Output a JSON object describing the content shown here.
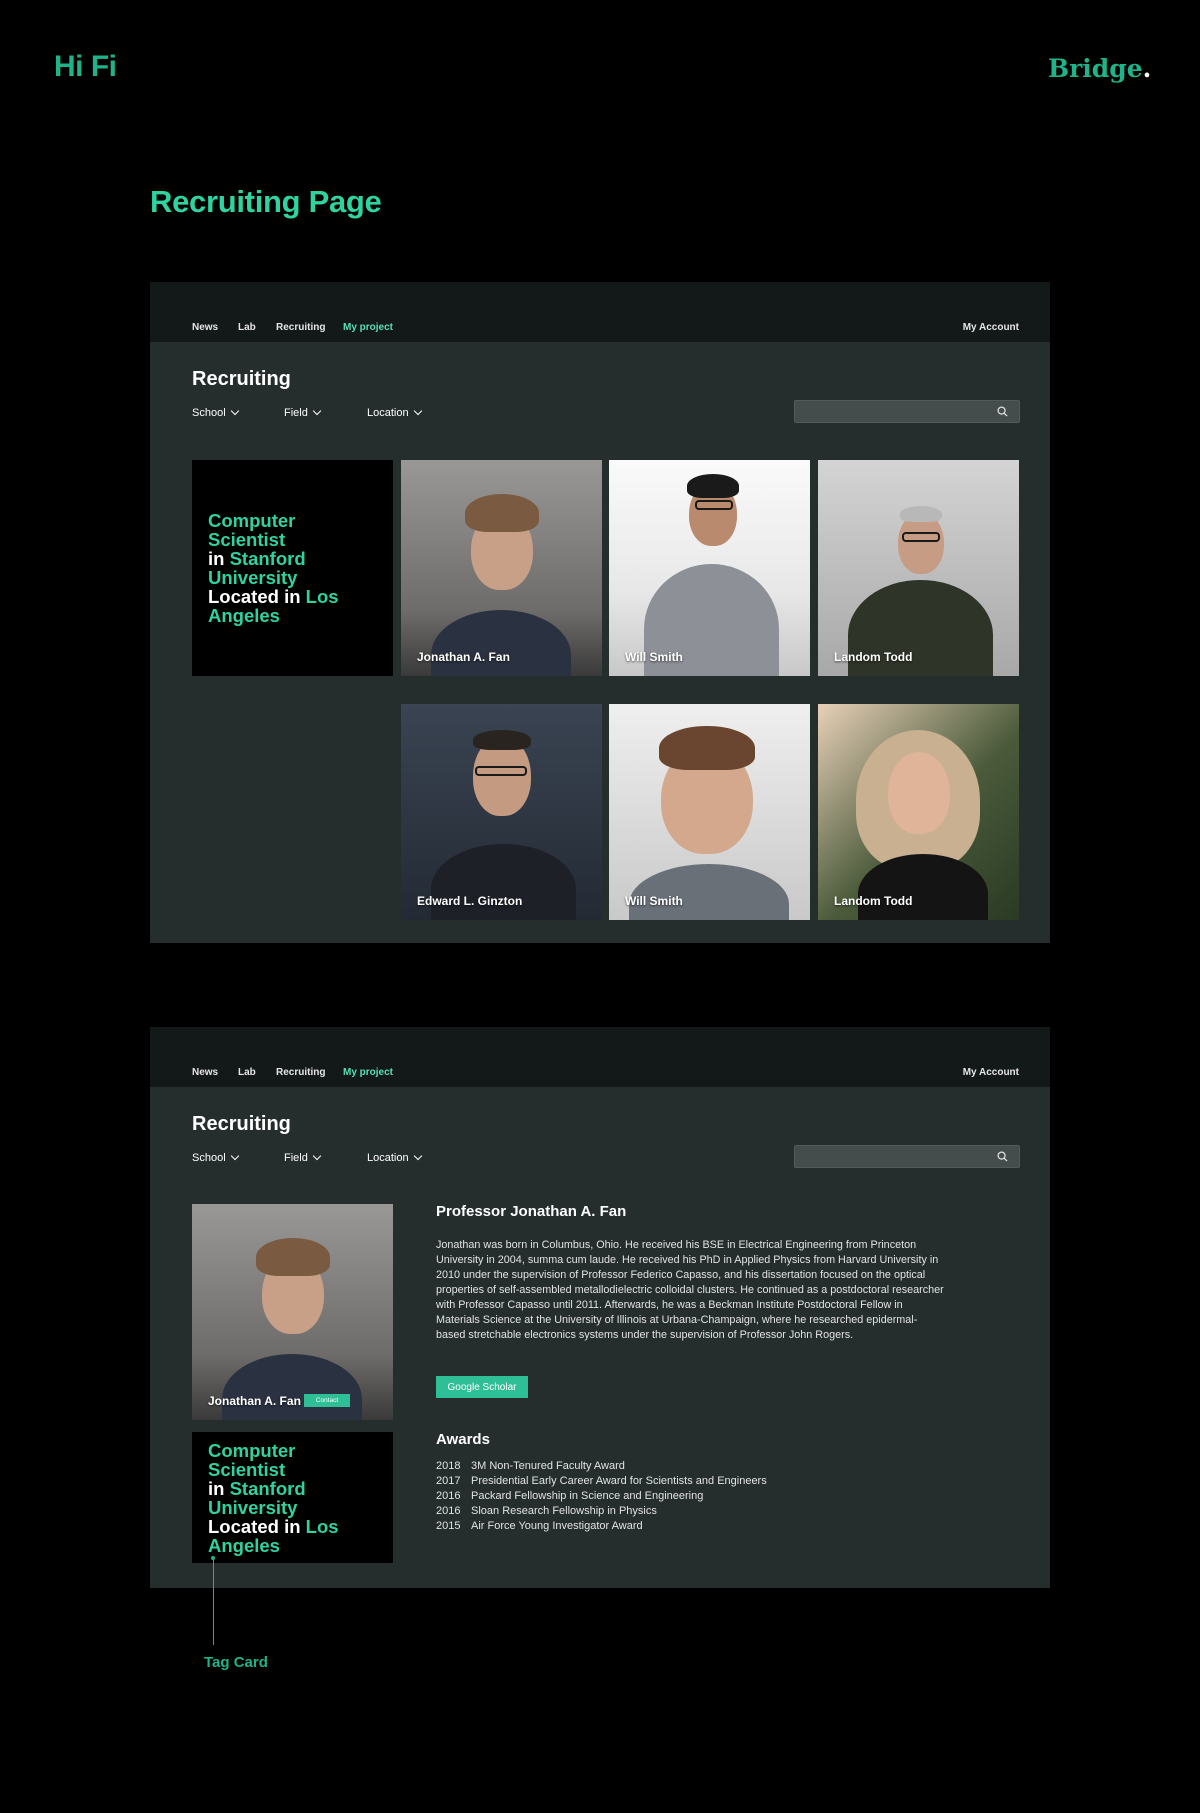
{
  "header": {
    "left_brand": "Hi Fi",
    "right_brand": "Bridge",
    "right_brand_dot": "."
  },
  "section_title": "Recruiting Page",
  "nav": {
    "items": [
      "News",
      "Lab",
      "Recruiting",
      "My project"
    ],
    "active": "My project",
    "account": "My Account"
  },
  "page": {
    "title": "Recruiting",
    "filters": [
      "School",
      "Field",
      "Location"
    ],
    "search": {
      "placeholder": ""
    }
  },
  "tag_card": {
    "parts": [
      {
        "text": "Computer Scientist",
        "highlight": true
      },
      {
        "text": "in",
        "highlight": false
      },
      {
        "text": "Stanford University",
        "highlight": true
      },
      {
        "text": "Located in",
        "highlight": false
      },
      {
        "text": "Los Angeles",
        "highlight": true
      }
    ]
  },
  "grid": {
    "people": [
      {
        "name": "Jonathan A. Fan"
      },
      {
        "name": "Will Smith"
      },
      {
        "name": "Landom Todd"
      },
      {
        "name": "Edward L. Ginzton"
      },
      {
        "name": "Will Smith"
      },
      {
        "name": "Landom Todd"
      }
    ]
  },
  "detail": {
    "card_name": "Jonathan A. Fan",
    "contact_label": "Contact",
    "name": "Professor Jonathan A. Fan",
    "bio": "Jonathan was born in Columbus, Ohio. He received his BSE in Electrical Engineering from Princeton University in 2004, summa cum laude. He received his PhD in Applied Physics from Harvard University in 2010 under the supervision of Professor Federico Capasso, and his dissertation focused on the optical properties of self-assembled metallodielectric colloidal clusters. He continued as a postdoctoral researcher with Professor Capasso until 2011. Afterwards, he was a Beckman Institute Postdoctoral Fellow in Materials Science at the University of Illinois at Urbana-Champaign, where he researched epidermal-based stretchable electronics systems under the supervision of Professor John Rogers.",
    "scholar_button": "Google Scholar",
    "awards_title": "Awards",
    "awards": [
      {
        "year": "2018",
        "title": "3M Non-Tenured Faculty Award"
      },
      {
        "year": "2017",
        "title": "Presidential Early Career Award for Scientists and Engineers"
      },
      {
        "year": "2016",
        "title": "Packard Fellowship in Science and Engineering"
      },
      {
        "year": "2016",
        "title": "Sloan Research Fellowship in Physics"
      },
      {
        "year": "2015",
        "title": "Air Force Young Investigator Award"
      }
    ]
  },
  "annotation": {
    "label": "Tag Card"
  },
  "colors": {
    "accent": "#2ed3a0",
    "brand": "#1fb389",
    "panel": "#252d2d",
    "nav": "#131818"
  },
  "icons": {
    "search": "search-icon",
    "dropdown": "chevron-down-icon"
  }
}
